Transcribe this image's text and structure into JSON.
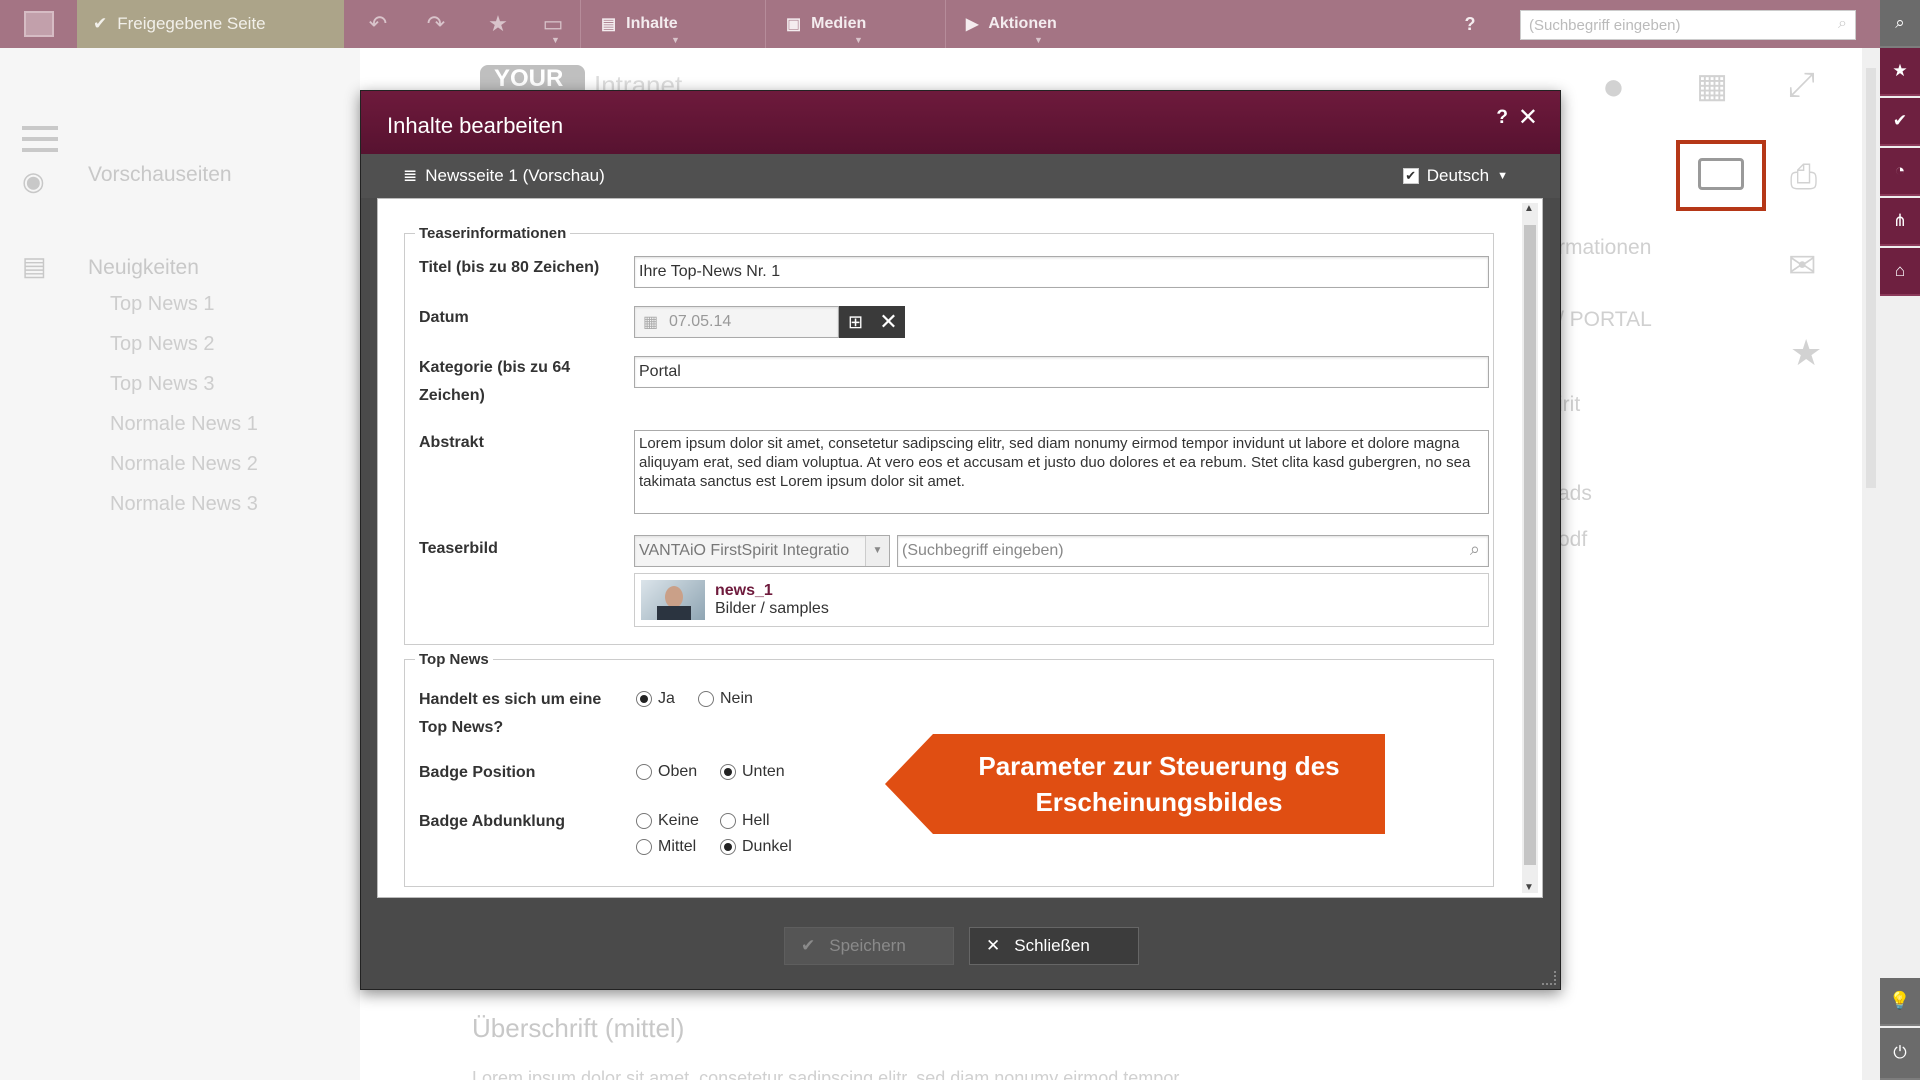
{
  "topbar": {
    "release_label": "Freigegebene Seite",
    "menus": [
      {
        "label": "Inhalte"
      },
      {
        "label": "Medien"
      },
      {
        "label": "Aktionen"
      }
    ],
    "help_label": "?",
    "search_placeholder": "(Suchbegriff eingeben)"
  },
  "leftnav": {
    "preview_label": "Vorschauseiten",
    "news_label": "Neuigkeiten",
    "items": [
      "Top News 1",
      "Top News 2",
      "Top News 3",
      "Normale News 1",
      "Normale News 2",
      "Normale News 3"
    ]
  },
  "background": {
    "brand_logo": "YOUR",
    "brand_sub": "Intranet",
    "right_texts": [
      "rmationen",
      "/ PORTAL",
      "irit",
      "ads",
      "odf"
    ],
    "heading": "Überschrift (mittel)",
    "lorem": "Lorem ipsum dolor sit amet, consetetur sadipscing elitr, sed diam nonumy eirmod tempor"
  },
  "dialog": {
    "title": "Inhalte bearbeiten",
    "help": "?",
    "page_label": "Newsseite 1 (Vorschau)",
    "language": "Deutsch",
    "teaser": {
      "legend": "Teaserinformationen",
      "title_label": "Titel (bis zu 80 Zeichen)",
      "title_value": "Ihre Top-News Nr. 1",
      "date_label": "Datum",
      "date_value": "07.05.14",
      "category_label": "Kategorie (bis zu 64 Zeichen)",
      "category_value": "Portal",
      "abstract_label": "Abstrakt",
      "abstract_value": "Lorem ipsum dolor sit amet, consetetur sadipscing elitr, sed diam nonumy eirmod tempor invidunt ut labore et dolore magna aliquyam erat, sed diam voluptua. At vero eos et accusam et justo duo dolores et ea rebum. Stet clita kasd gubergren, no sea takimata sanctus est Lorem ipsum dolor sit amet.",
      "image_label": "Teaserbild",
      "image_source": "VANTAiO FirstSpirit Integratio",
      "image_search_placeholder": "(Suchbegriff eingeben)",
      "image_name": "news_1",
      "image_path": "Bilder / samples"
    },
    "topnews": {
      "legend": "Top News",
      "is_top_label": "Handelt es sich um eine Top News?",
      "is_top_options": [
        {
          "label": "Ja",
          "selected": true
        },
        {
          "label": "Nein",
          "selected": false
        }
      ],
      "badge_pos_label": "Badge Position",
      "badge_pos_options": [
        {
          "label": "Oben",
          "selected": false
        },
        {
          "label": "Unten",
          "selected": true
        }
      ],
      "badge_dark_label": "Badge Abdunklung",
      "badge_dark_options": [
        {
          "label": "Keine",
          "selected": false
        },
        {
          "label": "Hell",
          "selected": false
        },
        {
          "label": "Mittel",
          "selected": false
        },
        {
          "label": "Dunkel",
          "selected": true
        }
      ]
    },
    "callout": "Parameter zur Steuerung des Erscheinungsbildes",
    "save_label": "Speichern",
    "close_label": "Schließen"
  },
  "colors": {
    "brand": "#6e1a3c",
    "callout": "#e04e12",
    "highlight": "#b53717"
  }
}
